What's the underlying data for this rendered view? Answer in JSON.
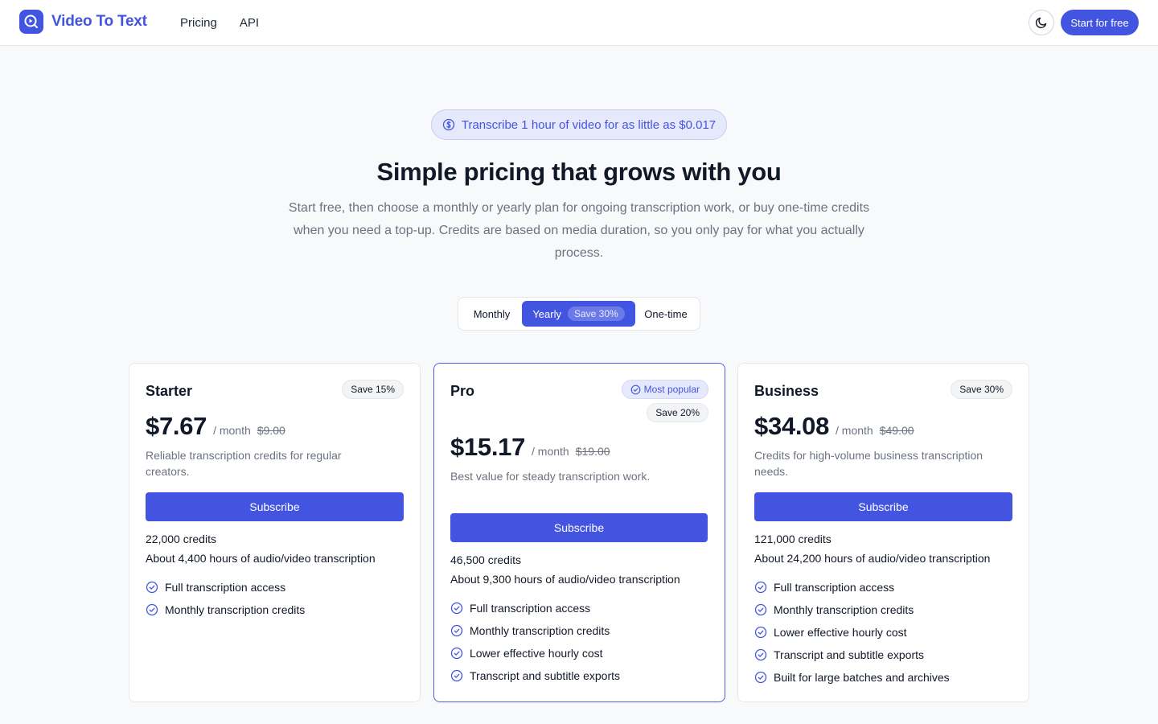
{
  "header": {
    "brand": "Video To Text",
    "nav": [
      "Pricing",
      "API"
    ],
    "cta_label": "Start for free",
    "theme_icon": "moon-icon"
  },
  "hero": {
    "promo": "Transcribe 1 hour of video for as little as $0.017",
    "title": "Simple pricing that grows with you",
    "subtitle": "Start free, then choose a monthly or yearly plan for ongoing transcription work, or buy one-time credits when you need a top-up. Credits are based on media duration, so you only pay for what you actually process."
  },
  "billing_toggle": {
    "monthly": "Monthly",
    "yearly": "Yearly",
    "yearly_badge": "Save 30%",
    "one_time": "One-time",
    "selected": "yearly"
  },
  "plans": [
    {
      "name": "Starter",
      "save_badge": "Save 15%",
      "price": "$7.67",
      "period": "/ month",
      "original_price": "$9.00",
      "description": "Reliable transcription credits for regular creators.",
      "button": "Subscribe",
      "credits_value": "22,000",
      "credits_unit": "credits",
      "hours": "About 4,400 hours of audio/video transcription",
      "features": [
        "Full transcription access",
        "Monthly transcription credits"
      ]
    },
    {
      "name": "Pro",
      "popular_badge": "Most popular",
      "save_badge": "Save 20%",
      "price": "$15.17",
      "period": "/ month",
      "original_price": "$19.00",
      "description": "Best value for steady transcription work.",
      "button": "Subscribe",
      "credits_value": "46,500",
      "credits_unit": "credits",
      "hours": "About 9,300 hours of audio/video transcription",
      "features": [
        "Full transcription access",
        "Monthly transcription credits",
        "Lower effective hourly cost",
        "Transcript and subtitle exports"
      ]
    },
    {
      "name": "Business",
      "save_badge": "Save 30%",
      "price": "$34.08",
      "period": "/ month",
      "original_price": "$49.00",
      "description": "Credits for high-volume business transcription needs.",
      "button": "Subscribe",
      "credits_value": "121,000",
      "credits_unit": "credits",
      "hours": "About 24,200 hours of audio/video transcription",
      "features": [
        "Full transcription access",
        "Monthly transcription credits",
        "Lower effective hourly cost",
        "Transcript and subtitle exports",
        "Built for large batches and archives"
      ]
    }
  ],
  "colors": {
    "accent": "#4355e0",
    "accent_soft": "#e6e9fb",
    "muted_text": "#6b7280",
    "background": "#f8f9fb"
  }
}
